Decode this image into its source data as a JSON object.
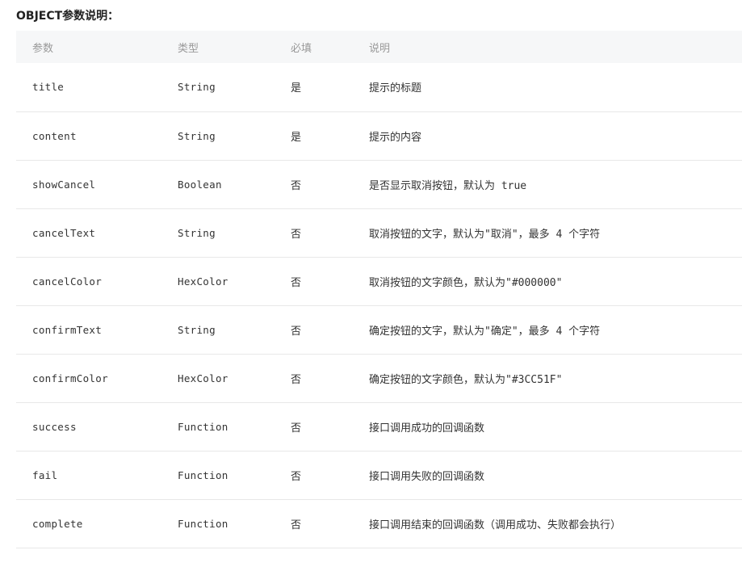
{
  "section_title": "OBJECT参数说明：",
  "table": {
    "headers": [
      "参数",
      "类型",
      "必填",
      "说明"
    ],
    "rows": [
      [
        "title",
        "String",
        "是",
        "提示的标题"
      ],
      [
        "content",
        "String",
        "是",
        "提示的内容"
      ],
      [
        "showCancel",
        "Boolean",
        "否",
        "是否显示取消按钮，默认为 true"
      ],
      [
        "cancelText",
        "String",
        "否",
        "取消按钮的文字，默认为\"取消\"，最多 4 个字符"
      ],
      [
        "cancelColor",
        "HexColor",
        "否",
        "取消按钮的文字颜色，默认为\"#000000\""
      ],
      [
        "confirmText",
        "String",
        "否",
        "确定按钮的文字，默认为\"确定\"，最多 4 个字符"
      ],
      [
        "confirmColor",
        "HexColor",
        "否",
        "确定按钮的文字颜色，默认为\"#3CC51F\""
      ],
      [
        "success",
        "Function",
        "否",
        "接口调用成功的回调函数"
      ],
      [
        "fail",
        "Function",
        "否",
        "接口调用失败的回调函数"
      ],
      [
        "complete",
        "Function",
        "否",
        "接口调用结束的回调函数（调用成功、失败都会执行）"
      ]
    ]
  }
}
